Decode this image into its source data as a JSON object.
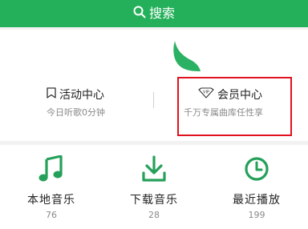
{
  "search": {
    "label": "搜索"
  },
  "cards": [
    {
      "title": "活动中心",
      "subtitle": "今日听歌0分钟",
      "icon": "bookmark-icon"
    },
    {
      "title": "会员中心",
      "subtitle": "千万专属曲库任性享",
      "icon": "vip-badge-icon",
      "badge": "VIP",
      "highlighted": true
    }
  ],
  "tiles": [
    {
      "label": "本地音乐",
      "count": "76",
      "icon": "music-note-icon"
    },
    {
      "label": "下载音乐",
      "count": "28",
      "icon": "download-icon"
    },
    {
      "label": "最近播放",
      "count": "199",
      "icon": "clock-icon"
    }
  ],
  "colors": {
    "brand": "#24b05a",
    "highlight_border": "#e0121d",
    "icon": "#25a05a",
    "muted_text": "#8a8a8a"
  }
}
